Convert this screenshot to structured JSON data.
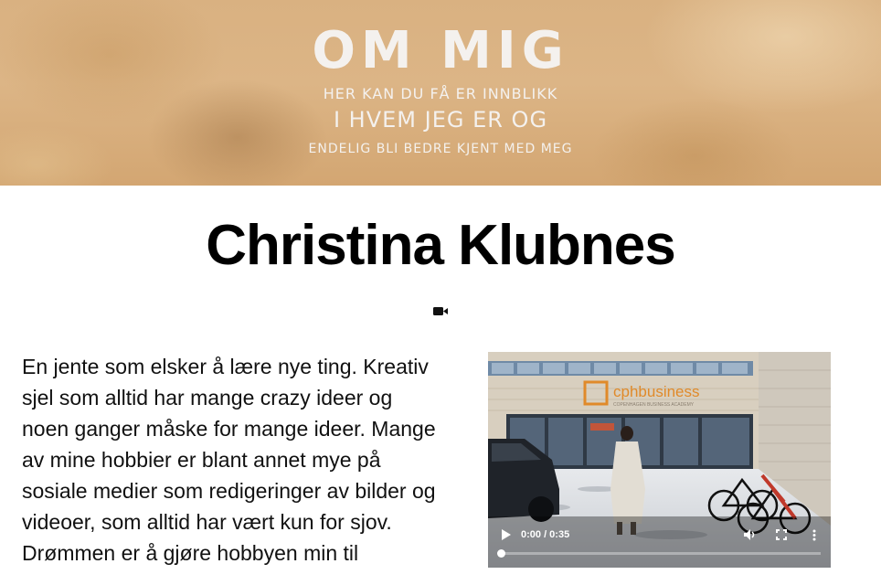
{
  "hero": {
    "title": "OM MIG",
    "line1": "HER KAN DU FÅ ER INNBLIKK",
    "line2": "I HVEM JEG ER OG",
    "line3": "ENDELIG BLI BEDRE KJENT MED MEG"
  },
  "name": "Christina Klubnes",
  "icons": {
    "video": "video-camera-icon",
    "play": "play-icon",
    "volume": "volume-icon",
    "fullscreen": "fullscreen-icon",
    "more": "more-vertical-icon"
  },
  "bio": {
    "text": "En jente som elsker å lære nye ting. Kreativ sjel som alltid har mange crazy ideer og noen ganger måske for mange ideer. Mange av mine hobbier er blant annet mye på sosiale medier som redigeringer av bilder og videoer, som alltid har vært kun for sjov. Drømmen er å gjøre hobbyen min til"
  },
  "video": {
    "sign_brand": "cphbusiness",
    "sign_sub": "COPENHAGEN BUSINESS ACADEMY",
    "current_time": "0:00",
    "duration": "0:35",
    "time_display": "0:00 / 0:35",
    "progress": 0
  },
  "colors": {
    "hero_bg": "#d9b181",
    "hero_text": "#f4f1ee",
    "sign_accent": "#e08a2a"
  }
}
